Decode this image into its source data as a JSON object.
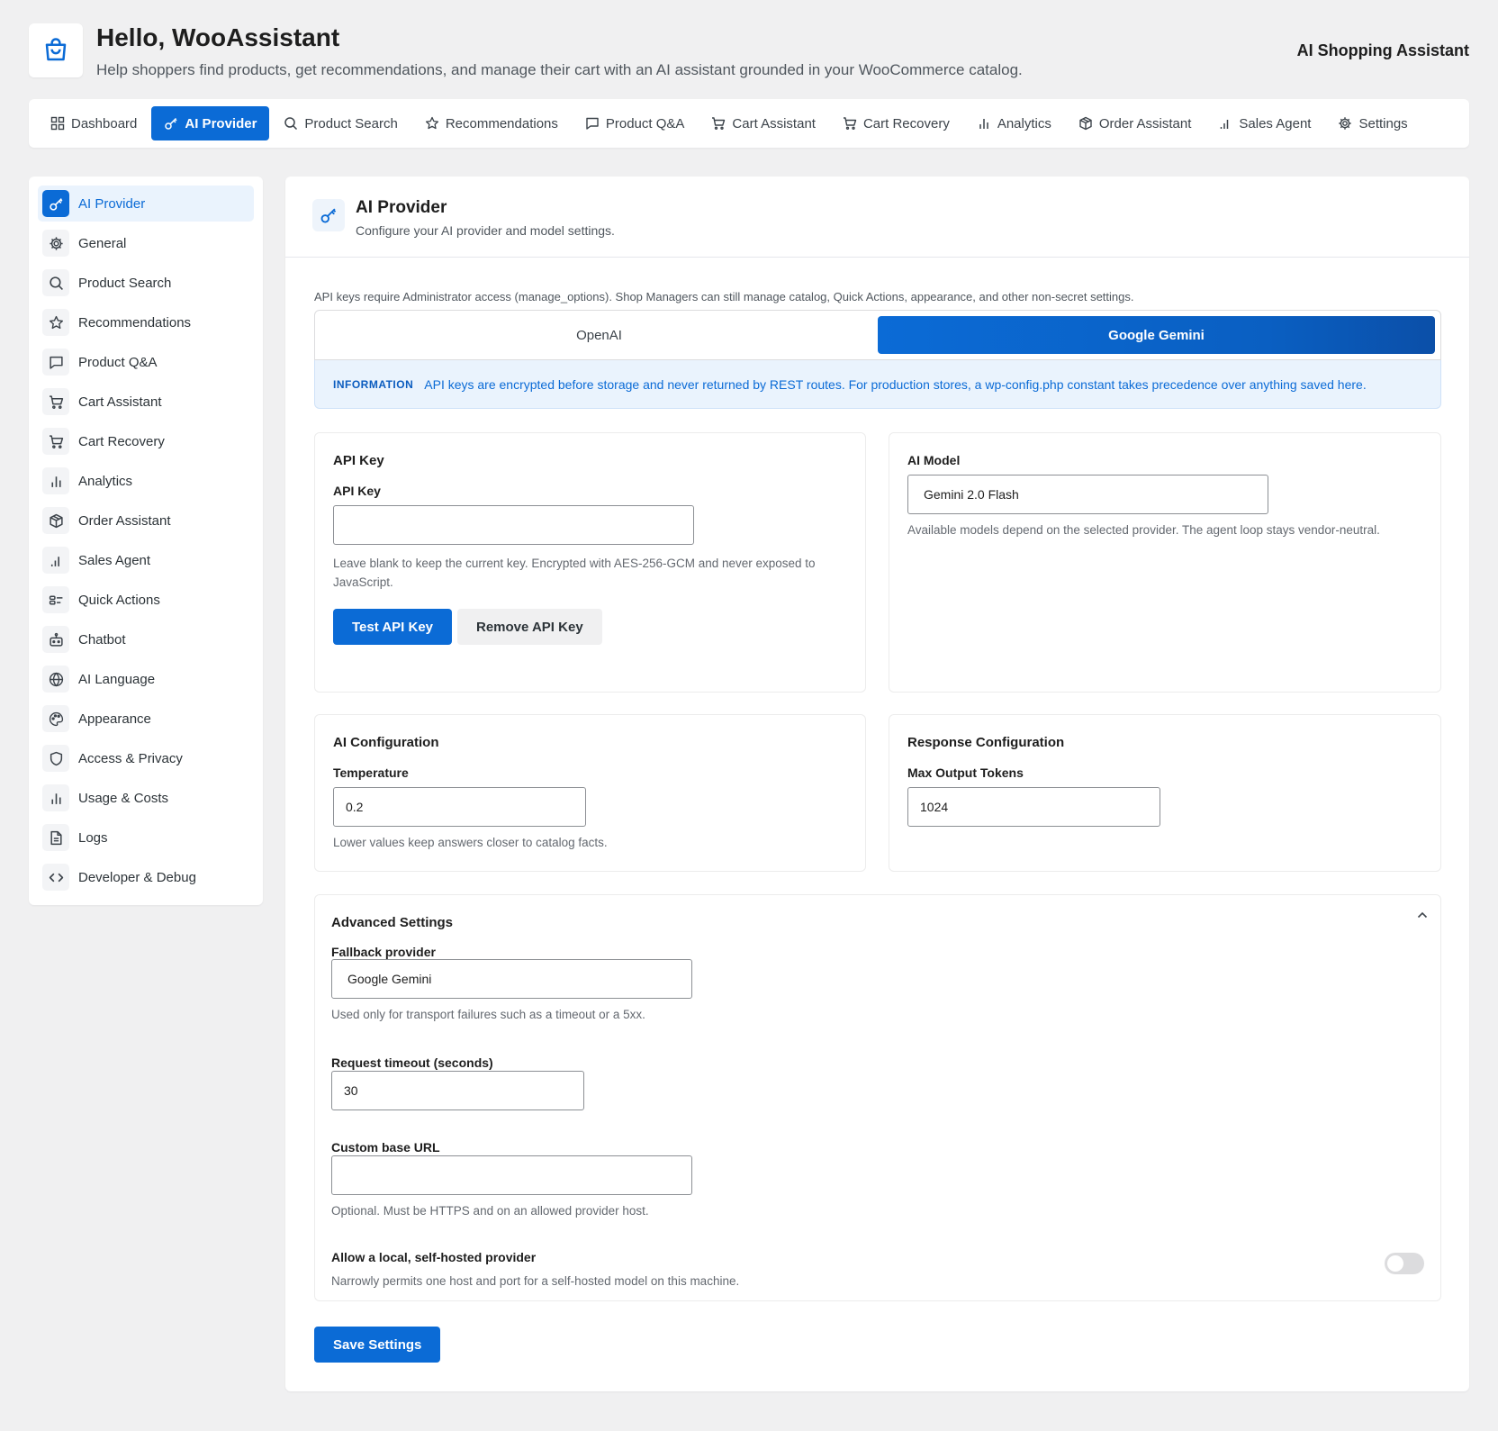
{
  "header": {
    "greeting": "Hello, WooAssistant",
    "tagline": "Help shoppers find products, get recommendations, and manage their cart with an AI assistant grounded in your WooCommerce catalog.",
    "brand": "AI Shopping Assistant",
    "logo_icon": "shopping-bag-icon"
  },
  "topnav": {
    "tabs": [
      {
        "label": "Dashboard",
        "icon": "grid-icon"
      },
      {
        "label": "AI Provider",
        "icon": "key-icon",
        "active": true
      },
      {
        "label": "Product Search",
        "icon": "search-icon"
      },
      {
        "label": "Recommendations",
        "icon": "star-icon"
      },
      {
        "label": "Product Q&A",
        "icon": "chat-icon"
      },
      {
        "label": "Cart Assistant",
        "icon": "cart-icon"
      },
      {
        "label": "Cart Recovery",
        "icon": "cart-icon"
      },
      {
        "label": "Analytics",
        "icon": "bar-chart-icon"
      },
      {
        "label": "Order Assistant",
        "icon": "box-icon"
      },
      {
        "label": "Sales Agent",
        "icon": "signal-icon"
      },
      {
        "label": "Settings",
        "icon": "gear-icon"
      }
    ]
  },
  "sidebar": {
    "items": [
      {
        "label": "AI Provider",
        "icon": "key-icon",
        "active": true
      },
      {
        "label": "General",
        "icon": "gear-icon"
      },
      {
        "label": "Product Search",
        "icon": "search-icon"
      },
      {
        "label": "Recommendations",
        "icon": "star-icon"
      },
      {
        "label": "Product Q&A",
        "icon": "chat-icon"
      },
      {
        "label": "Cart Assistant",
        "icon": "cart-icon"
      },
      {
        "label": "Cart Recovery",
        "icon": "cart-icon"
      },
      {
        "label": "Analytics",
        "icon": "bar-chart-icon"
      },
      {
        "label": "Order Assistant",
        "icon": "box-icon"
      },
      {
        "label": "Sales Agent",
        "icon": "signal-icon"
      },
      {
        "label": "Quick Actions",
        "icon": "quick-actions-icon"
      },
      {
        "label": "Chatbot",
        "icon": "robot-icon"
      },
      {
        "label": "AI Language",
        "icon": "globe-icon"
      },
      {
        "label": "Appearance",
        "icon": "palette-icon"
      },
      {
        "label": "Access & Privacy",
        "icon": "shield-icon"
      },
      {
        "label": "Usage & Costs",
        "icon": "bar-chart-icon"
      },
      {
        "label": "Logs",
        "icon": "document-icon"
      },
      {
        "label": "Developer & Debug",
        "icon": "code-icon"
      }
    ]
  },
  "main": {
    "title": "AI Provider",
    "subtitle": "Configure your AI provider and model settings.",
    "notice": "API keys require Administrator access (manage_options). Shop Managers can still manage catalog, Quick Actions, appearance, and other non-secret settings.",
    "providers": [
      {
        "label": "OpenAI",
        "active": false
      },
      {
        "label": "Google Gemini",
        "active": true
      }
    ],
    "info": {
      "label": "INFORMATION",
      "text": "API keys are encrypted before storage and never returned by REST routes. For production stores, a wp-config.php constant takes precedence over anything saved here."
    },
    "api_key_card": {
      "title": "API Key",
      "field_label": "API Key",
      "value": "",
      "help": "Leave blank to keep the current key. Encrypted with AES-256-GCM and never exposed to JavaScript.",
      "test_button": "Test API Key",
      "remove_button": "Remove API Key"
    },
    "model_card": {
      "title": "AI Model",
      "value": "Gemini 2.0 Flash",
      "help": "Available models depend on the selected provider. The agent loop stays vendor-neutral."
    },
    "ai_config_card": {
      "title": "AI Configuration",
      "field_label": "Temperature",
      "value": "0.2",
      "help": "Lower values keep answers closer to catalog facts."
    },
    "response_card": {
      "title": "Response Configuration",
      "field_label": "Max Output Tokens",
      "value": "1024"
    },
    "advanced": {
      "title": "Advanced Settings",
      "fallback_label": "Fallback provider",
      "fallback_value": "Google Gemini",
      "fallback_help": "Used only for transport failures such as a timeout or a 5xx.",
      "timeout_label": "Request timeout (seconds)",
      "timeout_value": "30",
      "base_url_label": "Custom base URL",
      "base_url_value": "",
      "base_url_help": "Optional. Must be HTTPS and on an allowed provider host.",
      "local_label": "Allow a local, self-hosted provider",
      "local_help": "Narrowly permits one host and port for a self-hosted model on this machine.",
      "local_enabled": false
    },
    "save_button": "Save Settings"
  },
  "colors": {
    "accent": "#0b6bd6",
    "background": "#f0f0f1",
    "info_bg": "#eaf3fd"
  }
}
